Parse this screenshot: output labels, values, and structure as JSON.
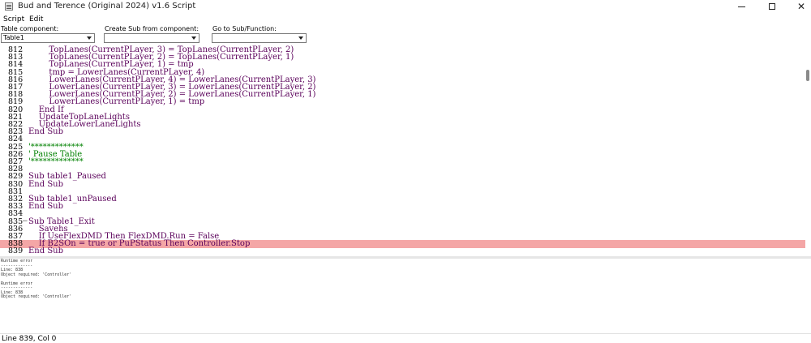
{
  "window": {
    "title": "Bud and Terence (Original 2024) v1.6 Script",
    "minimize_icon": "minimize-icon",
    "maximize_icon": "maximize-icon",
    "close_label": "✕"
  },
  "menu": [
    {
      "label": "Script"
    },
    {
      "label": "Edit"
    }
  ],
  "toolbar": {
    "table_component": {
      "label": "Table component:",
      "value": "Table1"
    },
    "create_sub": {
      "label": "Create Sub from component:",
      "value": ""
    },
    "goto_sub": {
      "label": "Go to Sub/Function:",
      "value": ""
    }
  },
  "colors": {
    "error_highlight": "#f4a6a6",
    "keyword": "#000080",
    "identifier": "#5a005a",
    "comment": "#008000"
  },
  "code_lines": [
    {
      "num": "812",
      "text": "        TopLanes(CurrentPLayer, 3) = TopLanes(CurrentPLayer, 2)"
    },
    {
      "num": "813",
      "text": "        TopLanes(CurrentPLayer, 2) = TopLanes(CurrentPLayer, 1)"
    },
    {
      "num": "814",
      "text": "        TopLanes(CurrentPLayer, 1) = tmp"
    },
    {
      "num": "815",
      "text": "        tmp = LowerLanes(CurrentPLayer, 4)"
    },
    {
      "num": "816",
      "text": "        LowerLanes(CurrentPLayer, 4) = LowerLanes(CurrentPLayer, 3)"
    },
    {
      "num": "817",
      "text": "        LowerLanes(CurrentPLayer, 3) = LowerLanes(CurrentPLayer, 2)"
    },
    {
      "num": "818",
      "text": "        LowerLanes(CurrentPLayer, 2) = LowerLanes(CurrentPLayer, 1)"
    },
    {
      "num": "819",
      "text": "        LowerLanes(CurrentPLayer, 1) = tmp"
    },
    {
      "num": "820",
      "text": "    End If"
    },
    {
      "num": "821",
      "text": "    UpdateTopLaneLights"
    },
    {
      "num": "822",
      "text": "    UpdateLowerLaneLights"
    },
    {
      "num": "823",
      "text": "End Sub"
    },
    {
      "num": "824",
      "text": ""
    },
    {
      "num": "825",
      "text": "'*************"
    },
    {
      "num": "826",
      "text": "' Pause Table"
    },
    {
      "num": "827",
      "text": "'*************"
    },
    {
      "num": "828",
      "text": ""
    },
    {
      "num": "829",
      "text": "Sub table1_Paused"
    },
    {
      "num": "830",
      "text": "End Sub"
    },
    {
      "num": "831",
      "text": ""
    },
    {
      "num": "832",
      "text": "Sub table1_unPaused"
    },
    {
      "num": "833",
      "text": "End Sub"
    },
    {
      "num": "834",
      "text": ""
    },
    {
      "num": "835",
      "text": "Sub Table1_Exit",
      "fold": "−"
    },
    {
      "num": "836",
      "text": "    Savehs"
    },
    {
      "num": "837",
      "text": "    If UseFlexDMD Then FlexDMD.Run = False"
    },
    {
      "num": "838",
      "text": "    If B2SOn = true or PuPStatus Then Controller.Stop",
      "error": true
    },
    {
      "num": "839",
      "text": "End Sub"
    }
  ],
  "output_lines": [
    "Runtime error",
    "-------------",
    "Line: 838",
    "Object required: 'Controller'",
    "",
    "Runtime error",
    "-------------",
    "Line: 838",
    "Object required: 'Controller'"
  ],
  "status": {
    "text": "Line 839, Col 0"
  }
}
